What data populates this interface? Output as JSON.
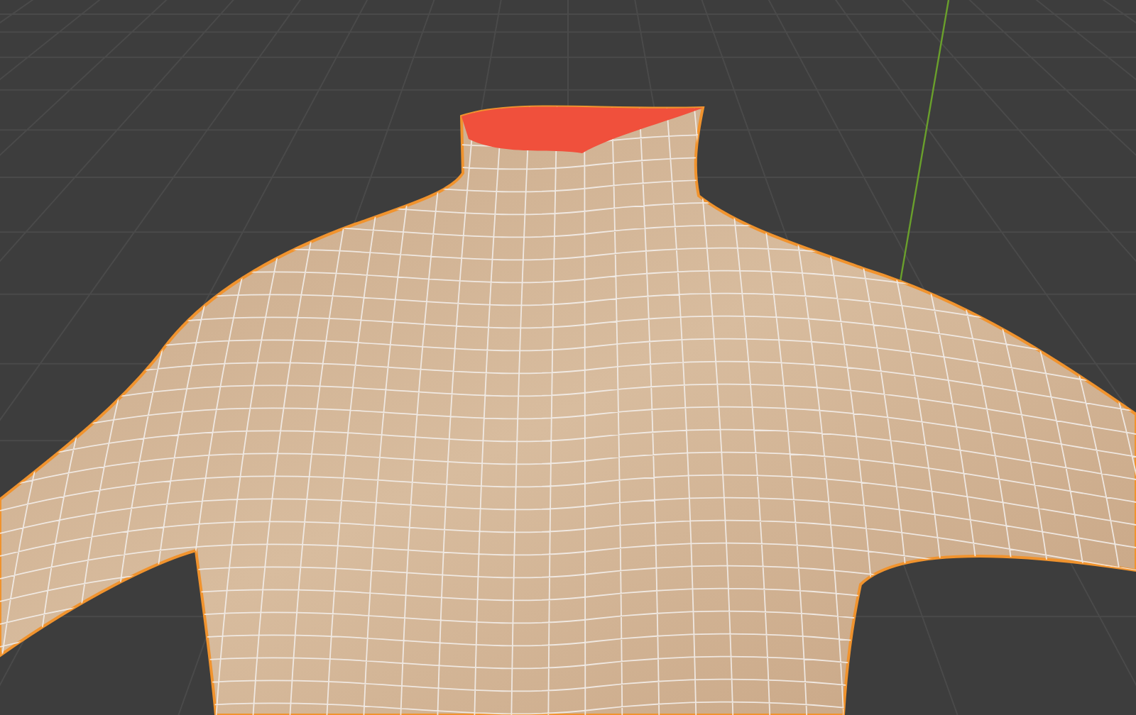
{
  "viewport": {
    "grid_floor": true,
    "y_axis_line": true,
    "mesh": {
      "wireframe": true,
      "selected_outline": true,
      "open_neck_face": true
    }
  }
}
